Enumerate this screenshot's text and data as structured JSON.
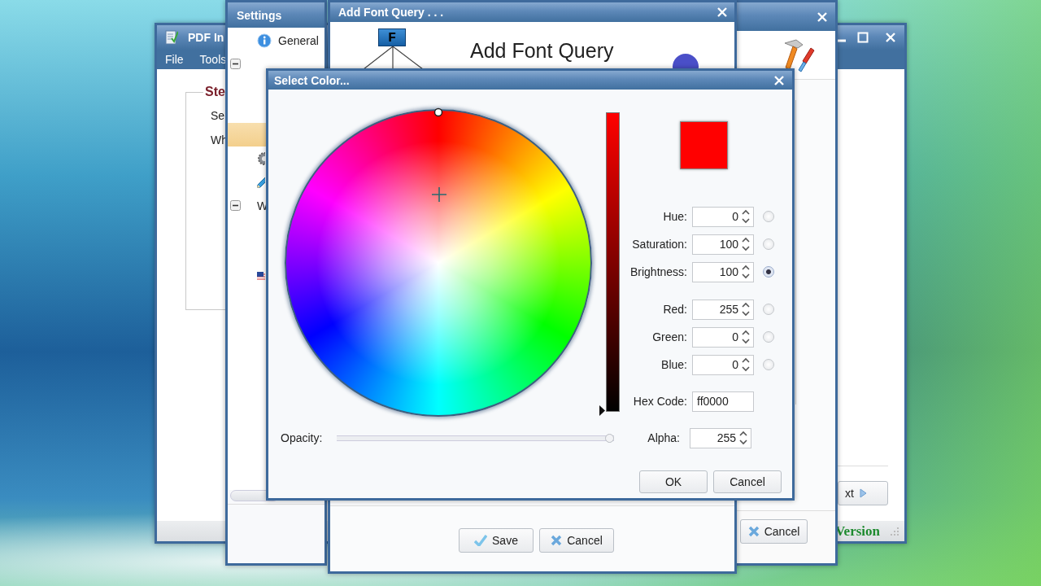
{
  "main_window": {
    "title": "PDF In",
    "menu": [
      "File",
      "Tools"
    ],
    "group_title": "Ste",
    "lines": [
      "Se",
      "Wh"
    ],
    "next_button": "xt",
    "status_text": "Version"
  },
  "settings_window": {
    "title": "Settings",
    "tree": [
      {
        "kind": "info",
        "label": "General",
        "selected": false
      },
      {
        "kind": "group",
        "expanded": true,
        "selected": false
      },
      {
        "kind": "blank",
        "selected": false
      },
      {
        "kind": "blank",
        "selected": false
      },
      {
        "kind": "blank",
        "selected": true
      },
      {
        "kind": "gear",
        "selected": false
      },
      {
        "kind": "pencil",
        "selected": false
      },
      {
        "kind": "group",
        "label": "W",
        "expanded": true,
        "selected": false
      },
      {
        "kind": "blank",
        "selected": false
      },
      {
        "kind": "blank",
        "selected": false
      },
      {
        "kind": "flag",
        "selected": false
      }
    ]
  },
  "tool_window": {
    "cancel_button": "Cancel"
  },
  "font_query_window": {
    "title": "Add Font Query . . .",
    "logo_letter": "F",
    "heading": "Add Font Query",
    "buttons": [
      {
        "kind": "save",
        "label": "Save"
      },
      {
        "kind": "cancel",
        "label": "Cancel"
      }
    ]
  },
  "color_dialog": {
    "title": "Select Color...",
    "fields": [
      {
        "kind": "spin",
        "label": "Hue:",
        "value": "0",
        "selected": false
      },
      {
        "kind": "spin",
        "label": "Saturation:",
        "value": "100",
        "selected": false
      },
      {
        "kind": "spin",
        "label": "Brightness:",
        "value": "100",
        "selected": true
      },
      {
        "kind": "spin",
        "label": "Red:",
        "value": "255",
        "selected": false
      },
      {
        "kind": "spin",
        "label": "Green:",
        "value": "0",
        "selected": false
      },
      {
        "kind": "spin",
        "label": "Blue:",
        "value": "0",
        "selected": false
      },
      {
        "kind": "text",
        "label": "Hex Code:",
        "value": "ff0000"
      }
    ],
    "opacity": {
      "label": "Opacity:",
      "level": 1
    },
    "alpha": {
      "label": "Alpha:",
      "value": "255"
    },
    "buttons": [
      "OK",
      "Cancel"
    ]
  }
}
